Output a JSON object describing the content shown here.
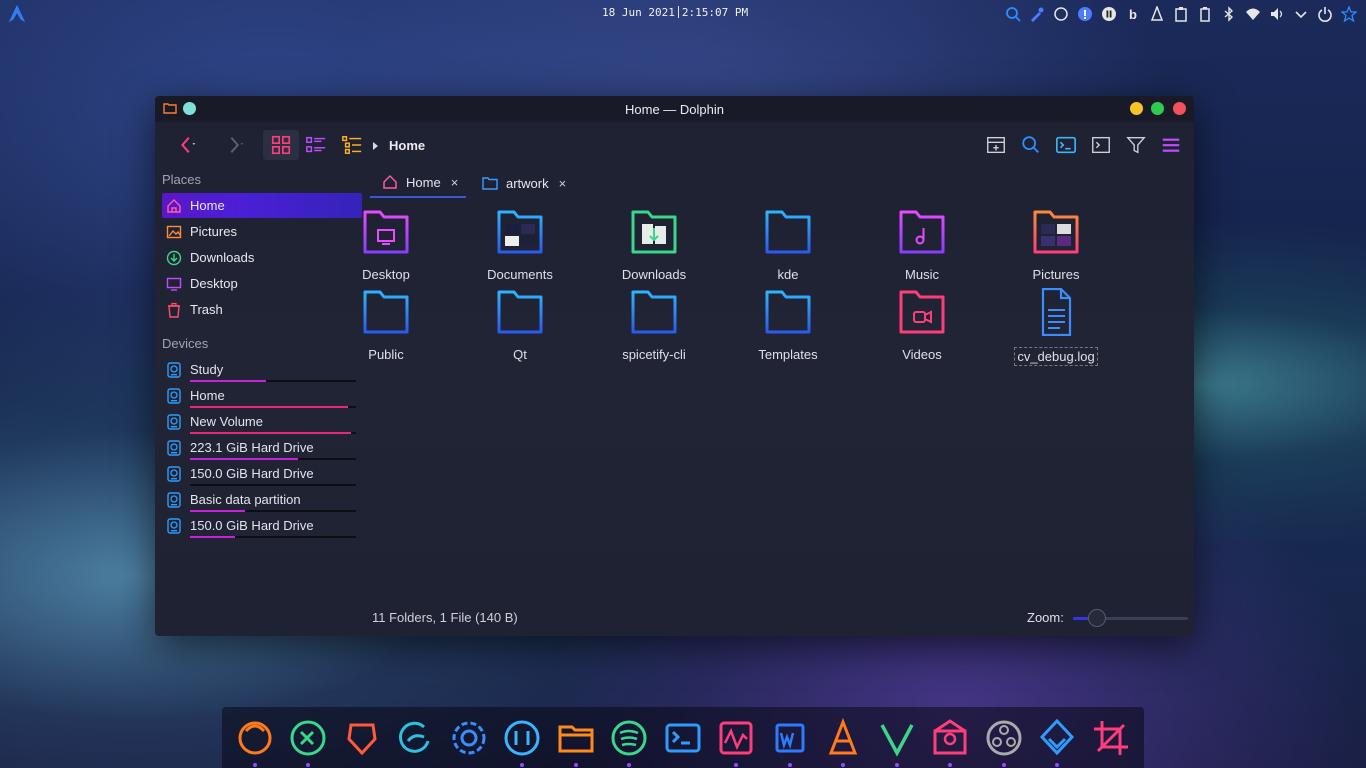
{
  "panel": {
    "clock_date": "18 Jun 2021",
    "clock_time": "2:15:07 PM",
    "tray_icons": [
      "search-icon",
      "color-picker-icon",
      "circle-icon",
      "info-icon",
      "pause-icon",
      "b-icon",
      "vlc-icon",
      "clipboard-icon",
      "battery-icon",
      "bluetooth-icon",
      "wifi-icon",
      "volume-icon",
      "chevron-down-icon",
      "power-icon",
      "star-icon"
    ],
    "tray_b_label": "b"
  },
  "window": {
    "title": "Home — Dolphin",
    "breadcrumb": "Home",
    "tabs": [
      {
        "label": "Home",
        "close": "×"
      },
      {
        "label": "artwork",
        "close": "×"
      }
    ],
    "sidebar": {
      "places_header": "Places",
      "places": [
        {
          "label": "Home",
          "icon": "home-icon",
          "color": "#ff5aa0"
        },
        {
          "label": "Pictures",
          "icon": "pictures-icon",
          "color": "#ff8a3a"
        },
        {
          "label": "Downloads",
          "icon": "downloads-icon",
          "color": "#3ad68a"
        },
        {
          "label": "Desktop",
          "icon": "desktop-icon",
          "color": "#c04bff"
        },
        {
          "label": "Trash",
          "icon": "trash-icon",
          "color": "#ff4d6a"
        }
      ],
      "devices_header": "Devices",
      "devices": [
        {
          "label": "Study",
          "usage": 0.46,
          "color": "#c821d8"
        },
        {
          "label": "Home",
          "usage": 0.95,
          "color": "#e8287a"
        },
        {
          "label": "New Volume",
          "usage": 0.97,
          "color": "#e8287a"
        },
        {
          "label": "223.1 GiB Hard Drive",
          "usage": 0.65,
          "color": "#c821d8"
        },
        {
          "label": "150.0 GiB Hard Drive",
          "usage": 0.0,
          "color": "#c821d8"
        },
        {
          "label": "Basic data partition",
          "usage": 0.33,
          "color": "#c821d8"
        },
        {
          "label": "150.0 GiB Hard Drive",
          "usage": 0.27,
          "color": "#c821d8"
        }
      ]
    },
    "files": [
      {
        "name": "Desktop",
        "type": "folder-desktop"
      },
      {
        "name": "Documents",
        "type": "folder-documents"
      },
      {
        "name": "Downloads",
        "type": "folder-downloads"
      },
      {
        "name": "kde",
        "type": "folder"
      },
      {
        "name": "Music",
        "type": "folder-music"
      },
      {
        "name": "Pictures",
        "type": "folder-pictures"
      },
      {
        "name": "Public",
        "type": "folder"
      },
      {
        "name": "Qt",
        "type": "folder"
      },
      {
        "name": "spicetify-cli",
        "type": "folder"
      },
      {
        "name": "Templates",
        "type": "folder"
      },
      {
        "name": "Videos",
        "type": "folder-videos"
      },
      {
        "name": "cv_debug.log",
        "type": "text-file"
      }
    ],
    "status": "11 Folders, 1 File (140 B)",
    "zoom_label": "Zoom:",
    "zoom_level": 0.15
  },
  "dock": {
    "apps": [
      "firefox-icon",
      "vscode-icon",
      "brave-icon",
      "edge-icon",
      "settings-icon",
      "qbittorrent-icon",
      "files-icon",
      "spotify-icon",
      "terminal-icon",
      "system-monitor-icon",
      "word-icon",
      "vlc-icon",
      "vivaldi-icon",
      "mail-icon",
      "obs-icon",
      "inkscape-icon",
      "crop-icon"
    ]
  },
  "colors": {
    "accent": "#4a1fd6",
    "folder_blue_top": "#2fb3ff",
    "folder_blue_bottom": "#2b5bf0",
    "window_bg": "#1e2233"
  }
}
